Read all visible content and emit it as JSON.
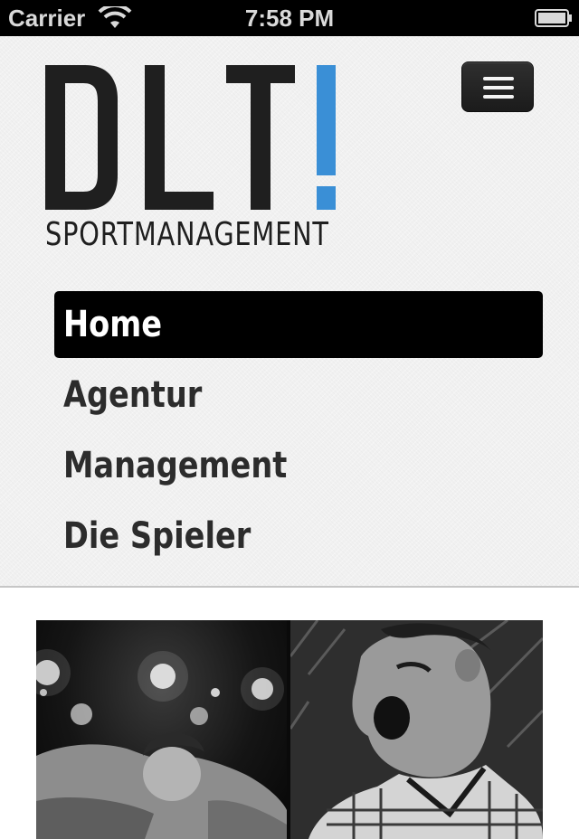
{
  "status_bar": {
    "carrier": "Carrier",
    "time": "7:58 PM",
    "wifi_icon": "wifi-icon",
    "battery_icon": "battery-icon"
  },
  "logo": {
    "letters": "DLT!",
    "subtitle": "SPORTMANAGEMENT",
    "accent_color": "#3a8fd6",
    "text_color": "#1f1f1f"
  },
  "menu_toggle": {
    "icon": "hamburger-icon"
  },
  "nav": {
    "items": [
      {
        "label": "Home",
        "active": true
      },
      {
        "label": "Agentur",
        "active": false
      },
      {
        "label": "Management",
        "active": false
      },
      {
        "label": "Die Spieler",
        "active": false
      }
    ]
  },
  "hero": {
    "left_image": "player-push-up-photo",
    "right_image": "player-shouting-photo"
  }
}
